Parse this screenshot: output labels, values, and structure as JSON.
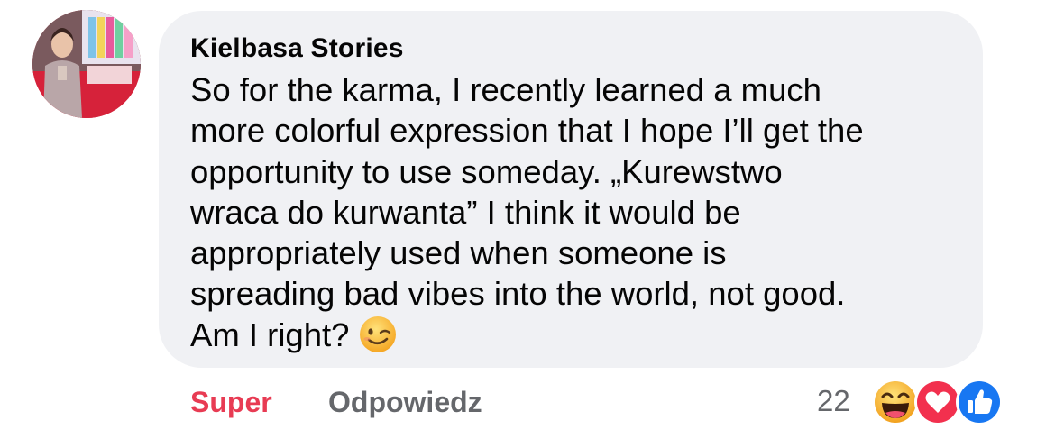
{
  "comment": {
    "author": "Kielbasa Stories",
    "lines": [
      "So for the karma, I recently learned a much",
      "more colorful expression that I hope I’ll get the",
      "opportunity to use someday. „Kurewstwo",
      "wraca do kurwanta” I think it would be",
      "appropriately used when someone is",
      "spreading bad vibes into the world, not good.",
      "Am I right?"
    ],
    "emoji_icon": "winking-face-icon"
  },
  "actions": {
    "reaction_label": "Super",
    "reaction_color": "#e83b53",
    "reply_label": "Odpowiedz",
    "reaction_count": "22",
    "reaction_icons": [
      "laughing-face-icon",
      "love-heart-icon",
      "like-thumb-icon"
    ]
  },
  "colors": {
    "bubble": "#f0f1f4",
    "text": "#050505",
    "secondary": "#65676b"
  }
}
